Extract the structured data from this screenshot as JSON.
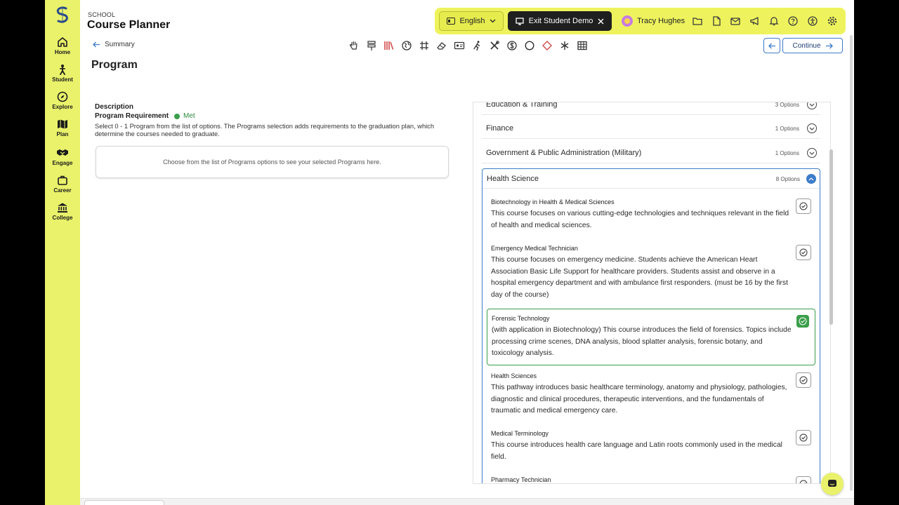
{
  "header": {
    "school_label": "SCHOOL",
    "app_title": "Course Planner",
    "language": "English",
    "exit_demo": "Exit Student Demo",
    "user_name": "Tracy Hughes"
  },
  "sidebar": {
    "items": [
      {
        "label": "Home",
        "icon": "home-icon"
      },
      {
        "label": "Student",
        "icon": "student-icon"
      },
      {
        "label": "Explore",
        "icon": "compass-icon"
      },
      {
        "label": "Plan",
        "icon": "map-icon"
      },
      {
        "label": "Engage",
        "icon": "handshake-icon"
      },
      {
        "label": "Career",
        "icon": "briefcase-icon"
      },
      {
        "label": "College",
        "icon": "institution-icon"
      }
    ]
  },
  "nav": {
    "back_label": "Summary",
    "page_title": "Program",
    "continue_label": "Continue"
  },
  "requirement": {
    "description_heading": "Description",
    "label": "Program Requirement",
    "status": "Met",
    "description": "Select 0 - 1 Program from the list of options. The Programs selection adds requirements to the graduation plan, which determine the courses needed to graduate.",
    "empty_message": "Choose from the list of Programs options to see your selected Programs here."
  },
  "categories": [
    {
      "name": "Education & Training",
      "count": "3 Options"
    },
    {
      "name": "Finance",
      "count": "1 Options"
    },
    {
      "name": "Government & Public Administration (Military)",
      "count": "1 Options"
    }
  ],
  "open_category": {
    "name": "Health Science",
    "count": "8 Options",
    "options": [
      {
        "title": "Biotechnology in Health & Medical Sciences",
        "desc": "This course focuses on various cutting-edge technologies and techniques relevant in the field of health and medical sciences.",
        "selected": false
      },
      {
        "title": "Emergency Medical Technician",
        "desc": "This course focuses on emergency medicine. Students achieve the American Heart Association Basic Life Support for healthcare providers. Students assist and observe in a hospital emergency department and with ambulance first responders. (must be 16 by the first day of the course)",
        "selected": false
      },
      {
        "title": "Forensic Technology",
        "desc": "(with application in Biotechnology) This course introduces the field of forensics. Topics include processing crime scenes, DNA analysis, blood splatter analysis, forensic botany, and toxicology analysis.",
        "selected": true
      },
      {
        "title": "Health Sciences",
        "desc": "This pathway introduces basic healthcare terminology, anatomy and physiology, pathologies, diagnostic and clinical procedures, therapeutic interventions, and the fundamentals of traumatic and medical emergency care.",
        "selected": false
      },
      {
        "title": "Medical Terminology",
        "desc": "This course introduces health care language and Latin roots commonly used in the medical field.",
        "selected": false
      },
      {
        "title": "Pharmacy Technician",
        "desc": "",
        "selected": false
      }
    ]
  },
  "colors": {
    "brand_yellow": "#e9f26a",
    "accent_blue": "#3d7cc9",
    "met_green": "#3a9e4a"
  }
}
